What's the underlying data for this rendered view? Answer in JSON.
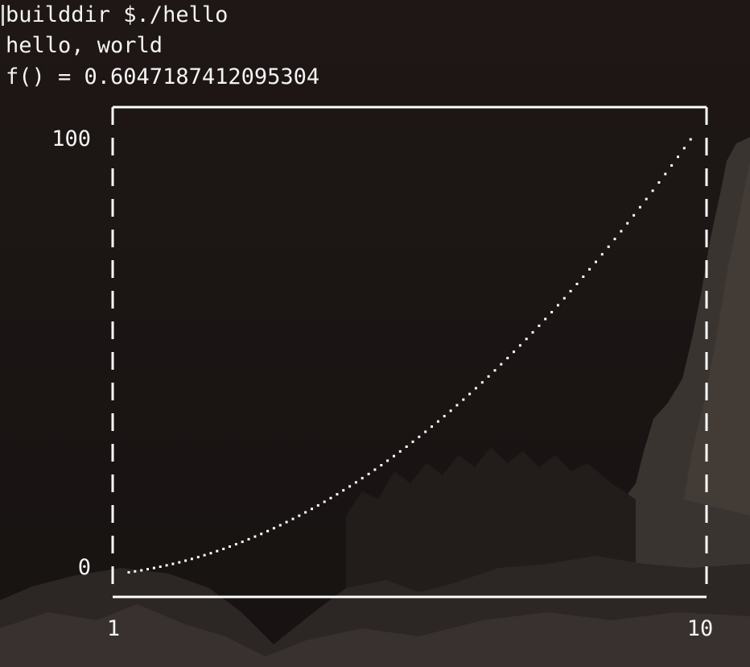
{
  "terminal": {
    "lines": [
      "builddir $./hello",
      "hello, world",
      "f() = 0.6047187412095304"
    ],
    "text_color": "#f4f4f4",
    "background_color": "#1c1614"
  },
  "chart_data": {
    "type": "scatter",
    "title": "",
    "xlabel": "",
    "ylabel": "",
    "xlim": [
      1,
      10
    ],
    "ylim": [
      0,
      100
    ],
    "x_tick_labels": [
      "1",
      "10"
    ],
    "y_tick_labels": [
      "0",
      "100"
    ],
    "grid": false,
    "legend": "none",
    "marker_color": "#ffffff",
    "frame_color": "#ffffff",
    "x": [
      1.0,
      1.1,
      1.2,
      1.3,
      1.4,
      1.5,
      1.6,
      1.7,
      1.8,
      1.9,
      2.0,
      2.1,
      2.2,
      2.3,
      2.4,
      2.5,
      2.6,
      2.7,
      2.8,
      2.9,
      3.0,
      3.1,
      3.2,
      3.3,
      3.4,
      3.5,
      3.6,
      3.7,
      3.8,
      3.9,
      4.0,
      4.1,
      4.2,
      4.3,
      4.4,
      4.5,
      4.6,
      4.7,
      4.8,
      4.9,
      5.0,
      5.1,
      5.2,
      5.3,
      5.4,
      5.5,
      5.6,
      5.7,
      5.8,
      5.9,
      6.0,
      6.1,
      6.2,
      6.3,
      6.4,
      6.5,
      6.6,
      6.7,
      6.8,
      6.9,
      7.0,
      7.1,
      7.2,
      7.3,
      7.4,
      7.5,
      7.6,
      7.7,
      7.8,
      7.9,
      8.0,
      8.1,
      8.2,
      8.3,
      8.4,
      8.5,
      8.6,
      8.7,
      8.8,
      8.9,
      9.0,
      9.1,
      9.2,
      9.3,
      9.4,
      9.5,
      9.6,
      9.7,
      9.8,
      9.9
    ],
    "y": [
      1.0,
      1.21,
      1.44,
      1.69,
      1.96,
      2.25,
      2.56,
      2.89,
      3.24,
      3.61,
      4.0,
      4.41,
      4.84,
      5.29,
      5.76,
      6.25,
      6.76,
      7.29,
      7.84,
      8.41,
      9.0,
      9.61,
      10.24,
      10.89,
      11.56,
      12.25,
      12.96,
      13.69,
      14.44,
      15.21,
      16.0,
      16.81,
      17.64,
      18.49,
      19.36,
      20.25,
      21.16,
      22.09,
      23.04,
      24.01,
      25.0,
      26.01,
      27.04,
      28.09,
      29.16,
      30.25,
      31.36,
      32.49,
      33.64,
      34.81,
      36.0,
      37.21,
      38.44,
      39.69,
      40.96,
      42.25,
      43.56,
      44.89,
      46.24,
      47.61,
      49.0,
      50.41,
      51.84,
      53.29,
      54.76,
      56.25,
      57.76,
      59.29,
      60.84,
      62.41,
      64.0,
      65.61,
      67.24,
      68.89,
      70.56,
      72.25,
      73.96,
      75.69,
      77.44,
      79.21,
      81.0,
      82.81,
      84.64,
      86.49,
      88.36,
      90.25,
      92.16,
      94.09,
      96.04,
      98.01
    ]
  }
}
